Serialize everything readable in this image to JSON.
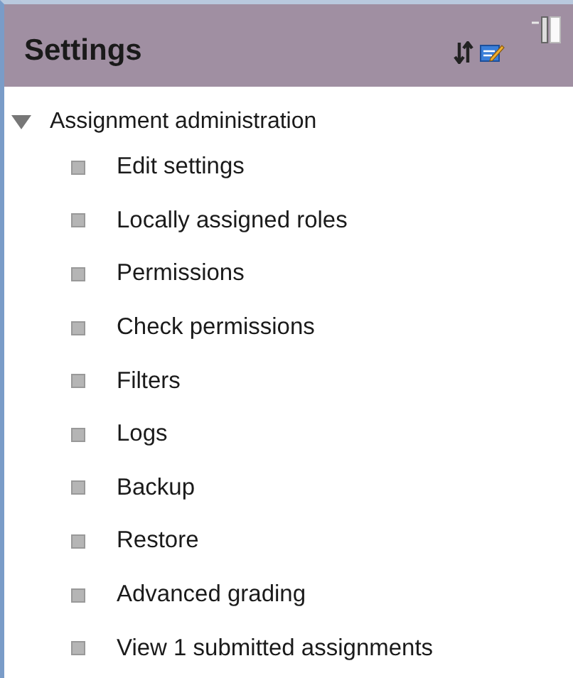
{
  "block": {
    "title": "Settings"
  },
  "tree": [
    {
      "label": "Assignment administration",
      "expanded": true,
      "children": [
        {
          "label": "Edit settings"
        },
        {
          "label": "Locally assigned roles"
        },
        {
          "label": "Permissions"
        },
        {
          "label": "Check permissions"
        },
        {
          "label": "Filters"
        },
        {
          "label": "Logs"
        },
        {
          "label": "Backup"
        },
        {
          "label": "Restore"
        },
        {
          "label": "Advanced grading"
        },
        {
          "label": "View 1 submitted assignments"
        }
      ]
    }
  ]
}
